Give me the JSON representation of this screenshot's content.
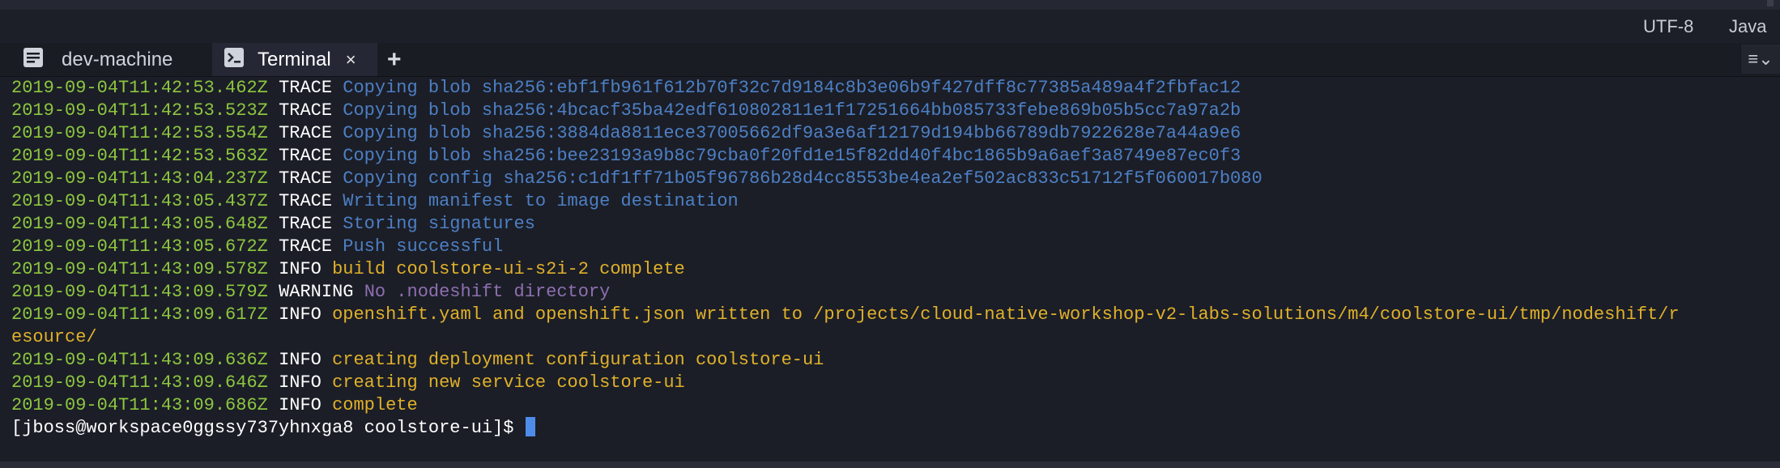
{
  "statusbar": {
    "encoding": "UTF-8",
    "language": "Java"
  },
  "tabs": [
    {
      "label": "dev-machine",
      "icon": "file-icon",
      "active": false
    },
    {
      "label": "Terminal",
      "icon": "terminal-icon",
      "active": true,
      "close": "×"
    }
  ],
  "add_tab": "+",
  "menu_icon": "≡⌄",
  "terminal": {
    "lines": [
      {
        "ts": "2019-09-04T11:42:53.462Z",
        "level": "TRACE",
        "msg": "Copying blob sha256:ebf1fb961f612b70f32c7d9184c8b3e06b9f427dff8c77385a489a4f2fbfac12"
      },
      {
        "ts": "2019-09-04T11:42:53.523Z",
        "level": "TRACE",
        "msg": "Copying blob sha256:4bcacf35ba42edf610802811e1f17251664bb085733febe869b05b5cc7a97a2b"
      },
      {
        "ts": "2019-09-04T11:42:53.554Z",
        "level": "TRACE",
        "msg": "Copying blob sha256:3884da8811ece37005662df9a3e6af12179d194bb66789db7922628e7a44a9e6"
      },
      {
        "ts": "2019-09-04T11:42:53.563Z",
        "level": "TRACE",
        "msg": "Copying blob sha256:bee23193a9b8c79cba0f20fd1e15f82dd40f4bc1865b9a6aef3a8749e87ec0f3"
      },
      {
        "ts": "2019-09-04T11:43:04.237Z",
        "level": "TRACE",
        "msg": "Copying config sha256:c1df1ff71b05f96786b28d4cc8553be4ea2ef502ac833c51712f5f060017b080"
      },
      {
        "ts": "2019-09-04T11:43:05.437Z",
        "level": "TRACE",
        "msg": "Writing manifest to image destination"
      },
      {
        "ts": "2019-09-04T11:43:05.648Z",
        "level": "TRACE",
        "msg": "Storing signatures"
      },
      {
        "ts": "2019-09-04T11:43:05.672Z",
        "level": "TRACE",
        "msg": "Push successful"
      },
      {
        "ts": "2019-09-04T11:43:09.578Z",
        "level": "INFO",
        "msg": "build coolstore-ui-s2i-2 complete"
      },
      {
        "ts": "2019-09-04T11:43:09.579Z",
        "level": "WARNING",
        "msg": "No .nodeshift directory"
      },
      {
        "ts": "2019-09-04T11:43:09.617Z",
        "level": "INFO",
        "msg": "openshift.yaml and openshift.json written to /projects/cloud-native-workshop-v2-labs-solutions/m4/coolstore-ui/tmp/nodeshift/r"
      },
      {
        "ts": "",
        "level": "",
        "msg": "esource/",
        "cont": "INFO"
      },
      {
        "ts": "2019-09-04T11:43:09.636Z",
        "level": "INFO",
        "msg": "creating deployment configuration coolstore-ui"
      },
      {
        "ts": "2019-09-04T11:43:09.646Z",
        "level": "INFO",
        "msg": "creating new service coolstore-ui"
      },
      {
        "ts": "2019-09-04T11:43:09.686Z",
        "level": "INFO",
        "msg": "complete"
      }
    ],
    "prompt": "[jboss@workspace0ggssy737yhnxga8 coolstore-ui]$"
  },
  "colors": {
    "timestamp": "#8dc63f",
    "trace_msg": "#4d7fc4",
    "info_msg": "#e0b02a",
    "warning_msg": "#8f6fb0",
    "cursor": "#4d8ce8"
  }
}
